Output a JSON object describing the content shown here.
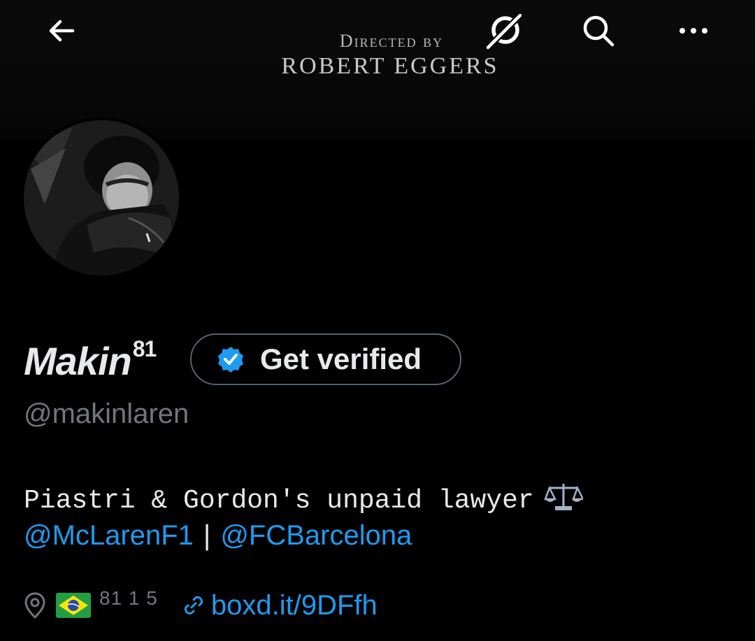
{
  "banner": {
    "credit_line1": "Directed by",
    "credit_line2": "ROBERT EGGERS"
  },
  "icons": {
    "back": "back-arrow-icon",
    "grok": "grok-icon",
    "search": "search-icon",
    "more": "more-icon"
  },
  "profile": {
    "display_name": "Makin",
    "display_name_sup": "81",
    "get_verified_label": "Get verified",
    "handle": "@makinlaren",
    "bio": "Piastri & Gordon's unpaid lawyer",
    "mentions": [
      "@McLarenF1",
      "@FCBarcelona"
    ],
    "mention_separator": "|",
    "location": "81 1 5",
    "website": "boxd.it/9DFfh"
  },
  "colors": {
    "accent": "#1d9bf0",
    "muted": "#71767b",
    "text": "#e7e9ea",
    "background": "#000000"
  }
}
